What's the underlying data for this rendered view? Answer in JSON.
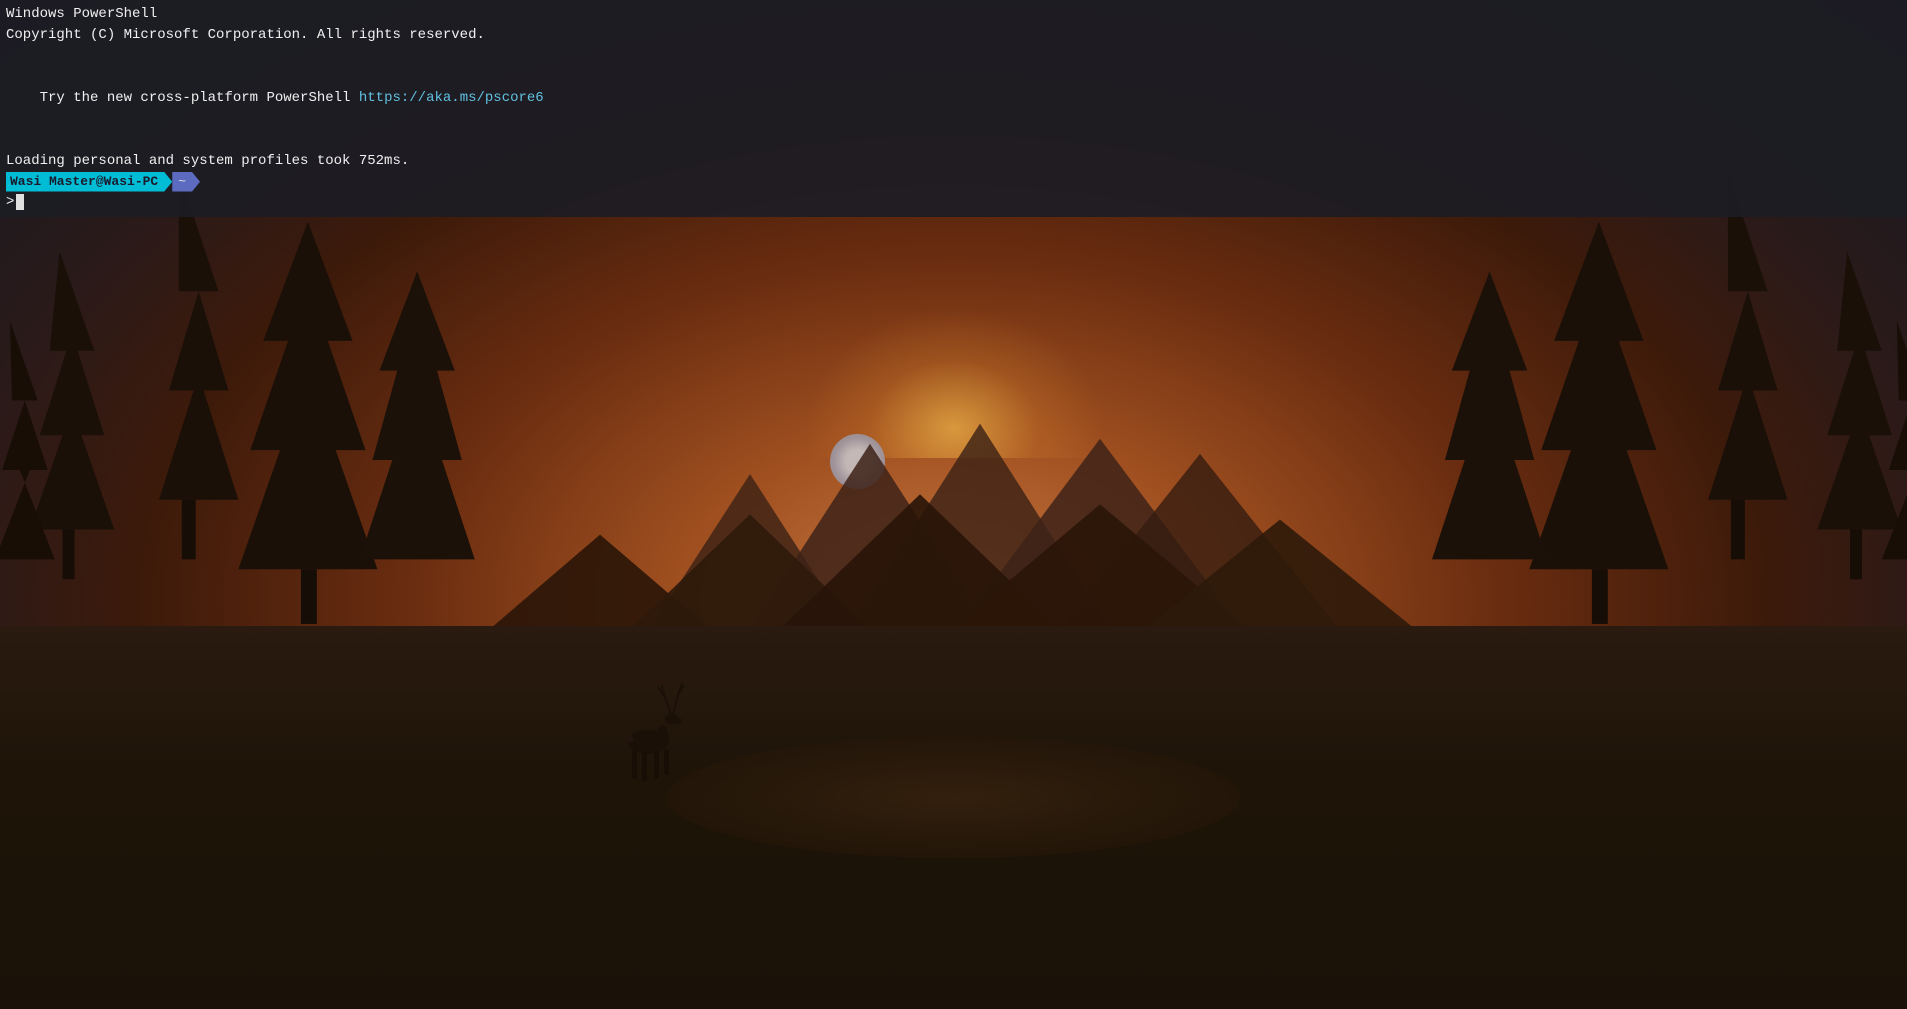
{
  "terminal": {
    "line1": "Windows PowerShell",
    "line2": "Copyright (C) Microsoft Corporation. All rights reserved.",
    "line3": "",
    "line4_prefix": "Try the new cross-platform PowerShell ",
    "line4_link": "https://aka.ms/pscore6",
    "line5": "",
    "line6": "Loading personal and system profiles took 752ms.",
    "prompt_user": "Wasi Master@Wasi-PC",
    "prompt_tilde": "~",
    "prompt_arrow": ">",
    "cursor_prompt": ">"
  },
  "background": {
    "description": "Sunset landscape with silhouette trees, mountains, deer, and lake"
  }
}
